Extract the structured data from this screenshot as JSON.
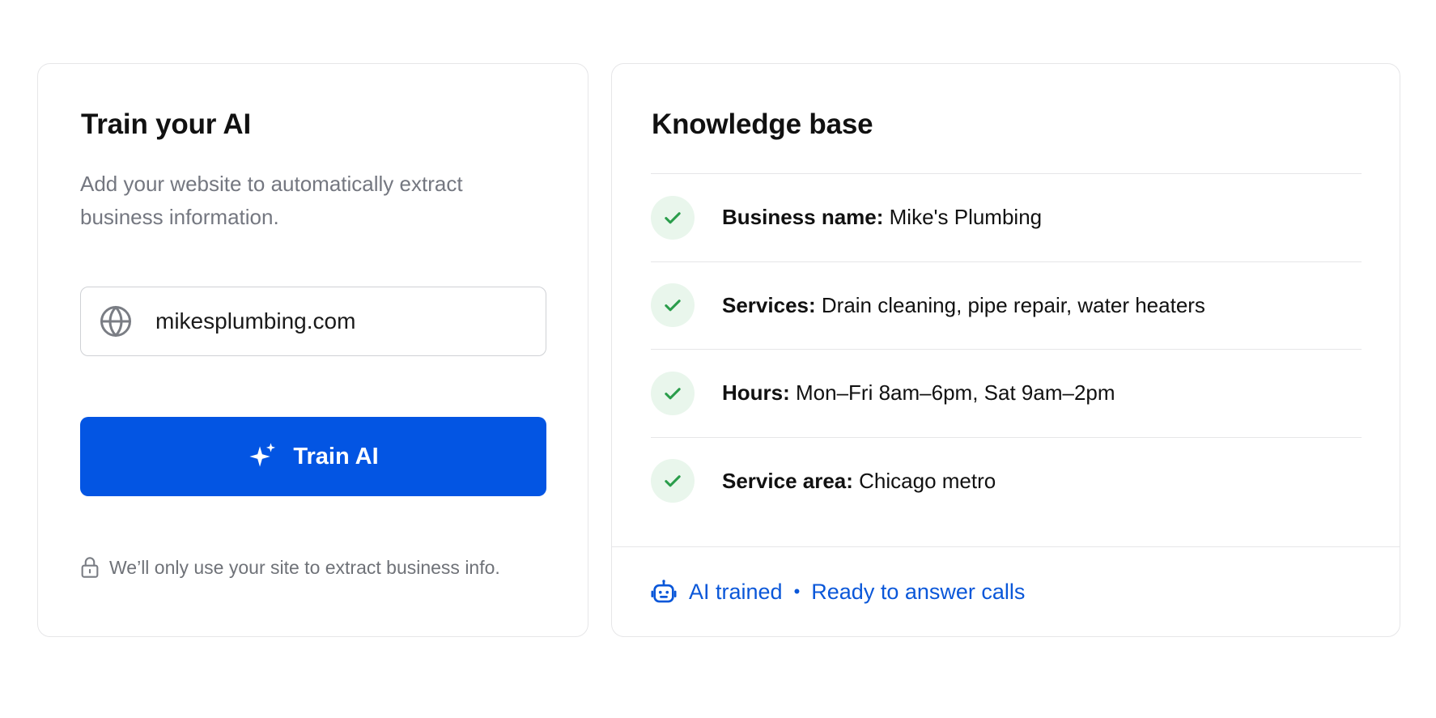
{
  "colors": {
    "accent": "#0355e3",
    "success": "#2a9d4b",
    "success_bg": "#e9f6ec",
    "muted_text": "#747780",
    "link_blue": "#0a57d9"
  },
  "train": {
    "title": "Train your AI",
    "description": "Add your website to automatically extract business information.",
    "url_input": {
      "value": "mikesplumbing.com",
      "icon": "globe-icon"
    },
    "button_label": "Train AI",
    "button_icon": "sparkle-icon",
    "privacy_note": "We’ll only use your site to extract business info.",
    "privacy_icon": "lock-icon"
  },
  "knowledge_base": {
    "title": "Knowledge base",
    "items": [
      {
        "label": "Business name:",
        "value": "Mike's Plumbing"
      },
      {
        "label": "Services:",
        "value": "Drain cleaning, pipe repair, water heaters"
      },
      {
        "label": "Hours:",
        "value": "Mon–Fri 8am–6pm, Sat 9am–2pm"
      },
      {
        "label": "Service area:",
        "value": "Chicago metro"
      }
    ],
    "status": {
      "icon": "robot-icon",
      "primary": "AI trained",
      "separator": "•",
      "secondary": "Ready to answer calls"
    }
  }
}
